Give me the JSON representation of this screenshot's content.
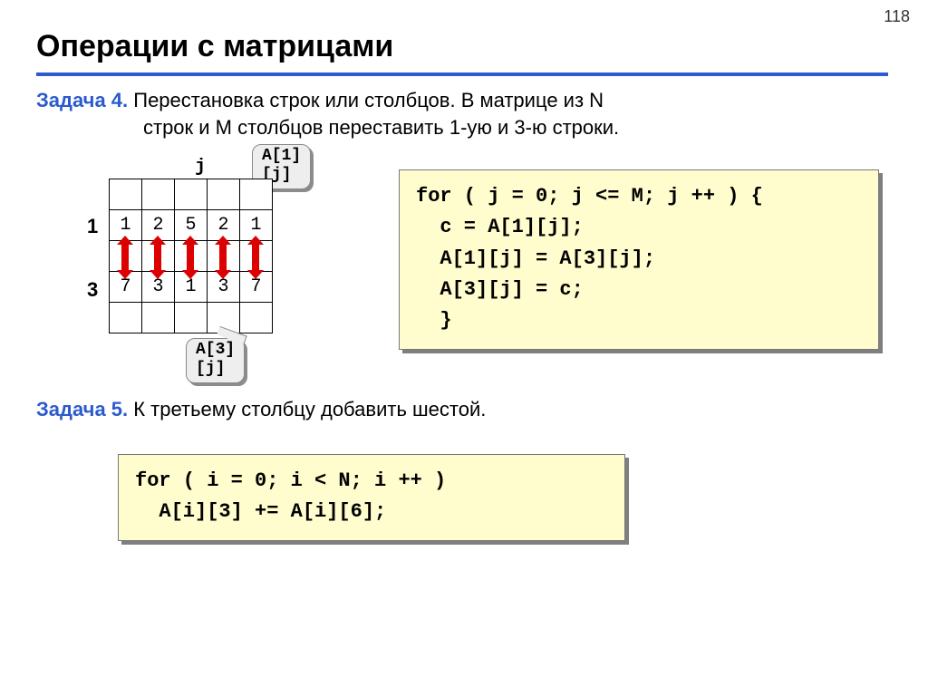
{
  "page_number": "118",
  "title": "Операции с матрицами",
  "task4": {
    "label": "Задача 4.",
    "line1": " Перестановка строк или столбцов. В матрице из N",
    "line2": "строк и M столбцов переставить 1-ую и 3-ю строки."
  },
  "diagram": {
    "j_label": "j",
    "callout_top_l1": "A[1]",
    "callout_top_l2": "[j]",
    "callout_bot_l1": "A[3]",
    "callout_bot_l2": "[j]",
    "row_label_1": "1",
    "row_label_3": "3",
    "row1": [
      "1",
      "2",
      "5",
      "2",
      "1"
    ],
    "row3": [
      "7",
      "3",
      "1",
      "3",
      "7"
    ]
  },
  "code1": {
    "l1": "for ( j = 0; j <= M; j ++ ) {",
    "l2": "  c = A[1][j];",
    "l3": "  A[1][j] = A[3][j];",
    "l4": "  A[3][j] = c;",
    "l5": "  }"
  },
  "task5": {
    "label": "Задача 5.",
    "text": " К третьему столбцу добавить шестой."
  },
  "code2": {
    "l1": "for ( i = 0; i < N; i ++ )",
    "l2": "  A[i][3] += A[i][6];"
  }
}
